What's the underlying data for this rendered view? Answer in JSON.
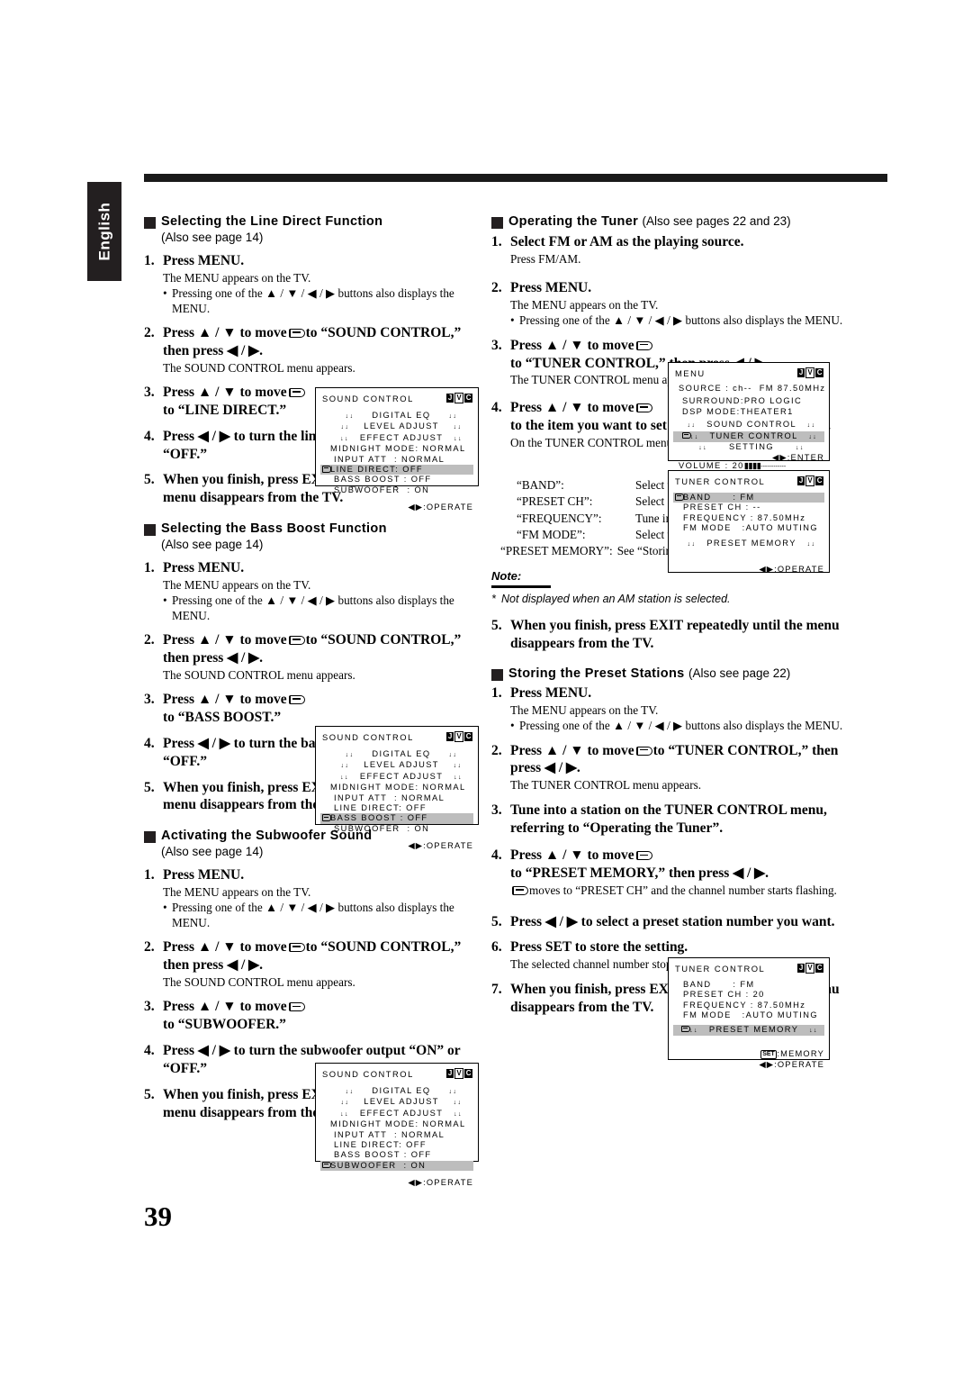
{
  "page": {
    "language_tab": "English",
    "page_number": "39"
  },
  "left_column": {
    "sections": [
      {
        "title": "Selecting the Line Direct Function",
        "subtitle": "(Also see page 14)",
        "steps": [
          {
            "n": "1.",
            "text": "Press MENU.",
            "desc": "The MENU appears on the TV.",
            "bullet": "Pressing one of the ▲ / ▼ / ◀ / ▶ buttons also displays the MENU."
          },
          {
            "n": "2.",
            "text_a": "Press ▲ / ▼ to move",
            "text_b": "to “SOUND CONTROL,” then press ◀ / ▶.",
            "desc": "The SOUND CONTROL menu appears."
          },
          {
            "n": "3.",
            "text_a": "Press ▲ / ▼ to move",
            "text_b": "to “LINE DIRECT.”"
          },
          {
            "n": "4.",
            "text": "Press ◀ / ▶ to turn the line direct function “ON” or “OFF.”"
          },
          {
            "n": "5.",
            "text": "When you finish, press EXIT repeatedly until the menu disappears from the TV."
          }
        ]
      },
      {
        "title": "Selecting the Bass Boost Function",
        "subtitle": "(Also see page 14)",
        "steps": [
          {
            "n": "1.",
            "text": "Press MENU.",
            "desc": "The MENU appears on the TV.",
            "bullet": "Pressing one of the ▲ / ▼ / ◀ / ▶ buttons also displays the MENU."
          },
          {
            "n": "2.",
            "text_a": "Press ▲ / ▼ to move",
            "text_b": "to “SOUND CONTROL,” then press ◀ / ▶.",
            "desc": "The SOUND CONTROL menu appears."
          },
          {
            "n": "3.",
            "text_a": "Press ▲ / ▼ to move",
            "text_b": "to “BASS BOOST.”"
          },
          {
            "n": "4.",
            "text": "Press ◀ / ▶ to turn the bass boost function “ON” or “OFF.”"
          },
          {
            "n": "5.",
            "text": "When you finish, press EXIT repeatedly until the menu disappears from the TV."
          }
        ]
      },
      {
        "title": "Activating the Subwoofer Sound",
        "subtitle": "(Also see page 14)",
        "steps": [
          {
            "n": "1.",
            "text": "Press MENU.",
            "desc": "The MENU appears on the TV.",
            "bullet": "Pressing one of the ▲ / ▼ / ◀ / ▶ buttons also displays the MENU."
          },
          {
            "n": "2.",
            "text_a": "Press ▲ / ▼ to move",
            "text_b": "to “SOUND CONTROL,” then press ◀ / ▶.",
            "desc": "The SOUND CONTROL menu appears."
          },
          {
            "n": "3.",
            "text_a": "Press ▲ / ▼ to move",
            "text_b": "to “SUBWOOFER.”"
          },
          {
            "n": "4.",
            "text": "Press ◀ / ▶ to turn the subwoofer output “ON” or “OFF.”"
          },
          {
            "n": "5.",
            "text": "When you finish, press EXIT repeatedly until the menu disappears from the TV."
          }
        ]
      }
    ]
  },
  "right_column": {
    "sections": [
      {
        "title": "Operating the Tuner",
        "title_note": "(Also see pages 22 and 23)",
        "steps": [
          {
            "n": "1.",
            "text": "Select FM or AM as the playing source.",
            "desc": "Press FM/AM."
          },
          {
            "n": "2.",
            "text": "Press MENU.",
            "desc": "The MENU appears on the TV.",
            "bullet": "Pressing one of the ▲ / ▼ / ◀ / ▶ buttons also displays the MENU."
          },
          {
            "n": "3.",
            "text_a": "Press ▲ / ▼ to move",
            "text_b": "to “TUNER CONTROL,” then press ◀ / ▶.",
            "desc": "The TUNER CONTROL menu appears."
          },
          {
            "n": "4.",
            "text_a": "Press ▲ / ▼ to move",
            "text_b": "to the item you want to set or adjust, then press ◀ / ▶.",
            "desc": "On the TUNER CONTROL menu, you can do the following:"
          },
          {
            "n": "5.",
            "text": "When you finish, press EXIT repeatedly until the menu disappears from the TV."
          }
        ],
        "definitions": [
          {
            "term": "“BAND”:",
            "def": "Select the band."
          },
          {
            "term": "“PRESET CH”:",
            "def": "Select a preset channel station."
          },
          {
            "term": "“FREQUENCY”:",
            "def": "Tune in a station manually."
          },
          {
            "term": "“FM MODE”:",
            "def": "Select the FM reception mode.*"
          }
        ],
        "definition_wide": {
          "term": "“PRESET MEMORY”:",
          "def": "See “Storing the Preset Stations.”"
        },
        "note": {
          "label": "Note:",
          "star": "*",
          "text": "Not displayed when an AM station is selected."
        }
      },
      {
        "title": "Storing the Preset Stations",
        "title_note": "(Also see page 22)",
        "steps": [
          {
            "n": "1.",
            "text": "Press MENU.",
            "desc": "The MENU appears on the TV.",
            "bullet": "Pressing one of the ▲ / ▼ / ◀ / ▶ buttons also displays the MENU."
          },
          {
            "n": "2.",
            "text_a": "Press ▲ / ▼ to move",
            "text_b": "to “TUNER CONTROL,” then press ◀ / ▶.",
            "desc": "The TUNER CONTROL menu appears."
          },
          {
            "n": "3.",
            "text": "Tune into a station on the TUNER CONTROL menu, referring to “Operating the Tuner”."
          },
          {
            "n": "4.",
            "text_a": "Press ▲ / ▼ to move",
            "text_b": "to “PRESET MEMORY,” then press ◀ / ▶.",
            "desc_hand": "moves to “PRESET CH” and the channel number starts flashing."
          },
          {
            "n": "5.",
            "text": "Press ◀ / ▶ to select a preset station number you want."
          },
          {
            "n": "6.",
            "text": "Press SET to store the setting.",
            "desc": "The selected channel number stops flashing."
          },
          {
            "n": "7.",
            "text": "When you finish, press EXIT repeatedly until the menu disappears from the TV."
          }
        ]
      }
    ]
  },
  "osd_panels": {
    "sound_control_line_direct": {
      "title": "SOUND CONTROL",
      "brand": "JVC",
      "rows": [
        {
          "text": "↓↓     DIGITAL EQ     ↓↓",
          "raw": "DIGITAL EQ",
          "highlight": false
        },
        {
          "text": "LEVEL ADJUST",
          "highlight": false
        },
        {
          "text": "EFFECT ADJUST",
          "highlight": false
        },
        {
          "text": "MIDNIGHT MODE: NORMAL",
          "highlight": false
        },
        {
          "text": "INPUT ATT   : NORMAL",
          "highlight": false
        },
        {
          "text": "LINE DIRECT: OFF",
          "highlight": true
        },
        {
          "text": "BASS BOOST : OFF",
          "highlight": false
        },
        {
          "text": "SUBWOOFER  : ON",
          "highlight": false
        }
      ],
      "footer": "◀▶:OPERATE"
    },
    "sound_control_bass_boost": {
      "title": "SOUND CONTROL",
      "brand": "JVC",
      "highlight_row": "BASS BOOST",
      "footer": "◀▶:OPERATE"
    },
    "sound_control_subwoofer": {
      "title": "SOUND CONTROL",
      "brand": "JVC",
      "highlight_row": "SUBWOOFER",
      "footer": "◀▶:OPERATE"
    },
    "menu": {
      "title": "MENU",
      "brand": "JVC",
      "source_label": "SOURCE",
      "source_value": "ch--  FM 87.50MHz",
      "surround_label": "SURROUND:",
      "surround_value": "PRO LOGIC",
      "dsp_label": "DSP MODE:",
      "dsp_value": "THEATER1",
      "items": [
        {
          "label": "SOUND CONTROL",
          "highlight": false
        },
        {
          "label": "TUNER CONTROL",
          "highlight": true
        },
        {
          "label": "SETTING",
          "highlight": false
        }
      ],
      "enter": "◀▶:ENTER",
      "volume_label": "VOLUME",
      "volume_value": "20"
    },
    "tuner_control_band": {
      "title": "TUNER CONTROL",
      "brand": "JVC",
      "rows": [
        {
          "label": "BAND",
          "sep": ":",
          "value": "FM",
          "highlight": true
        },
        {
          "label": "PRESET CH",
          "sep": ":",
          "value": "--",
          "highlight": false
        },
        {
          "label": "FREQUENCY",
          "sep": ":",
          "value": "87.50MHz",
          "highlight": false
        },
        {
          "label": "FM MODE",
          "sep": ":",
          "value": "AUTO MUTING",
          "highlight": false
        }
      ],
      "preset_memory": "PRESET MEMORY",
      "preset_memory_highlight": false,
      "footer": "◀▶:OPERATE"
    },
    "tuner_control_preset": {
      "title": "TUNER CONTROL",
      "brand": "JVC",
      "rows": [
        {
          "label": "BAND",
          "sep": ":",
          "value": "FM",
          "highlight": false
        },
        {
          "label": "PRESET CH",
          "sep": ":",
          "value": "20",
          "highlight": false
        },
        {
          "label": "FREQUENCY",
          "sep": ":",
          "value": "87.50MHz",
          "highlight": false
        },
        {
          "label": "FM MODE",
          "sep": ":",
          "value": "AUTO MUTING",
          "highlight": false
        }
      ],
      "preset_memory": "PRESET MEMORY",
      "preset_memory_highlight": true,
      "set_key": "SET",
      "set_label": ":MEMORY",
      "footer": "◀▶:OPERATE"
    }
  }
}
